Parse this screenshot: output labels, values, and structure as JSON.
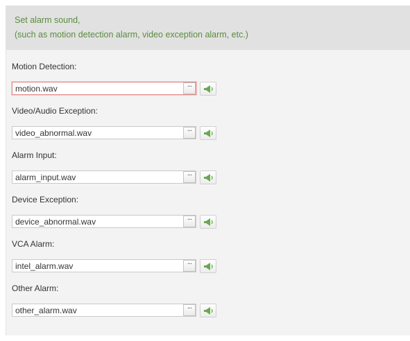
{
  "info": {
    "line1": "Set alarm sound,",
    "line2": "(such as motion detection alarm, video exception alarm, etc.)"
  },
  "fields": [
    {
      "label": "Motion Detection:",
      "value": "motion.wav",
      "error": true
    },
    {
      "label": "Video/Audio Exception:",
      "value": "video_abnormal.wav"
    },
    {
      "label": "Alarm Input:",
      "value": "alarm_input.wav"
    },
    {
      "label": "Device Exception:",
      "value": "device_abnormal.wav"
    },
    {
      "label": "VCA Alarm:",
      "value": "intel_alarm.wav"
    },
    {
      "label": "Other Alarm:",
      "value": "other_alarm.wav"
    }
  ],
  "browse_label": "···",
  "icons": {
    "browse": "ellipsis-icon",
    "play": "speaker-icon"
  },
  "colors": {
    "info_text": "#5b8c3f",
    "info_background": "#e1e1e1",
    "error_border": "#e08a8a",
    "speaker_icon": "#6aa84f"
  }
}
